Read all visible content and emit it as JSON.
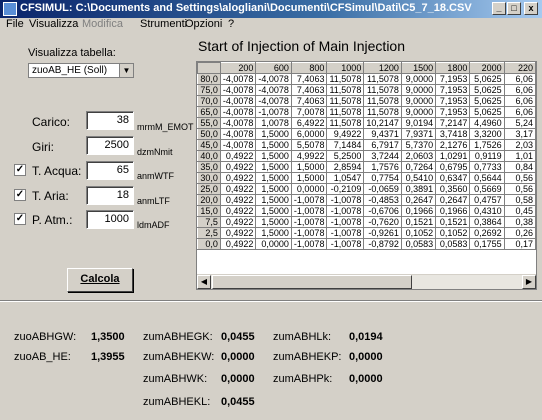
{
  "window": {
    "title": "CFSIMUL: C:\\Documents and Settings\\alogliani\\Documenti\\CFSimul\\Dati\\C5_7_18.CSV",
    "minimize": "_",
    "maximize": "□",
    "close": "x"
  },
  "menu": {
    "items": [
      "File",
      "Visualizza",
      "Modifica",
      "Strumenti",
      "Opzioni",
      "?"
    ]
  },
  "left": {
    "table_label": "Visualizza tabella:",
    "table_select": "zuoAB_HE (Soll)",
    "fields": [
      {
        "label": "Carico:",
        "value": "38",
        "unit": "mrmM_EMOT",
        "checked": false,
        "has_checkbox": false
      },
      {
        "label": "Giri:",
        "value": "2500",
        "unit": "dzmNmit",
        "checked": false,
        "has_checkbox": false
      },
      {
        "label": "T. Acqua:",
        "value": "65",
        "unit": "anmWTF",
        "checked": true,
        "has_checkbox": true
      },
      {
        "label": "T. Aria:",
        "value": "18",
        "unit": "anmLTF",
        "checked": true,
        "has_checkbox": true
      },
      {
        "label": "P. Atm.:",
        "value": "1000",
        "unit": "ldmADF",
        "checked": true,
        "has_checkbox": true
      }
    ],
    "calc_button": "Calcola"
  },
  "table": {
    "title": "Start of Injection of Main Injection",
    "columns": [
      "200",
      "600",
      "800",
      "1000",
      "1200",
      "1500",
      "1800",
      "2000",
      "220"
    ],
    "rows": [
      {
        "h": "80,0",
        "v": [
          "-4,0078",
          "-4,0078",
          "7,4063",
          "11,5078",
          "11,5078",
          "9,0000",
          "7,1953",
          "5,0625",
          "6,06"
        ]
      },
      {
        "h": "75,0",
        "v": [
          "-4,0078",
          "-4,0078",
          "7,4063",
          "11,5078",
          "11,5078",
          "9,0000",
          "7,1953",
          "5,0625",
          "6,06"
        ]
      },
      {
        "h": "70,0",
        "v": [
          "-4,0078",
          "-4,0078",
          "7,4063",
          "11,5078",
          "11,5078",
          "9,0000",
          "7,1953",
          "5,0625",
          "6,06"
        ]
      },
      {
        "h": "65,0",
        "v": [
          "-4,0078",
          "-1,0078",
          "7,0078",
          "11,5078",
          "11,5078",
          "9,0000",
          "7,1953",
          "5,0625",
          "6,06"
        ]
      },
      {
        "h": "55,0",
        "v": [
          "-4,0078",
          "1,0078",
          "6,4922",
          "11,5078",
          "10,2147",
          "9,0194",
          "7,2147",
          "4,4960",
          "5,24"
        ]
      },
      {
        "h": "50,0",
        "v": [
          "-4,0078",
          "1,5000",
          "6,0000",
          "9,4922",
          "9,4371",
          "7,9371",
          "3,7418",
          "3,3200",
          "3,17"
        ]
      },
      {
        "h": "45,0",
        "v": [
          "-4,0078",
          "1,5000",
          "5,5078",
          "7,1484",
          "6,7917",
          "5,7370",
          "2,1276",
          "1,7526",
          "2,03"
        ]
      },
      {
        "h": "40,0",
        "v": [
          "0,4922",
          "1,5000",
          "4,9922",
          "5,2500",
          "3,7244",
          "2,0603",
          "1,0291",
          "0,9119",
          "1,01"
        ]
      },
      {
        "h": "35,0",
        "v": [
          "0,4922",
          "1,5000",
          "1,5000",
          "2,8594",
          "1,7576",
          "0,7264",
          "0,6795",
          "0,7733",
          "0,84"
        ]
      },
      {
        "h": "30,0",
        "v": [
          "0,4922",
          "1,5000",
          "1,5000",
          "1,0547",
          "0,7754",
          "0,5410",
          "0,6347",
          "0,5644",
          "0,56"
        ]
      },
      {
        "h": "25,0",
        "v": [
          "0,4922",
          "1,5000",
          "0,0000",
          "-0,2109",
          "-0,0659",
          "0,3891",
          "0,3560",
          "0,5669",
          "0,56"
        ]
      },
      {
        "h": "20,0",
        "v": [
          "0,4922",
          "1,5000",
          "-1,0078",
          "-1,0078",
          "-0,4853",
          "0,2647",
          "0,2647",
          "0,4757",
          "0,58"
        ]
      },
      {
        "h": "15,0",
        "v": [
          "0,4922",
          "1,5000",
          "-1,0078",
          "-1,0078",
          "-0,6706",
          "0,1966",
          "0,1966",
          "0,4310",
          "0,45"
        ]
      },
      {
        "h": "7,5",
        "v": [
          "0,4922",
          "1,5000",
          "-1,0078",
          "-1,0078",
          "-0,7620",
          "0,1521",
          "0,1521",
          "0,3864",
          "0,38"
        ]
      },
      {
        "h": "2,5",
        "v": [
          "0,4922",
          "1,5000",
          "-1,0078",
          "-1,0078",
          "-0,9261",
          "0,1052",
          "0,1052",
          "0,2692",
          "0,26"
        ]
      },
      {
        "h": "0,0",
        "v": [
          "0,4922",
          "0,0000",
          "-1,0078",
          "-1,0078",
          "-0,8792",
          "0,0583",
          "0,0583",
          "0,1755",
          "0,17"
        ]
      }
    ]
  },
  "results": [
    {
      "label": "zuoABHGW:",
      "value": "1,3500"
    },
    {
      "label": "zuoAB_HE:",
      "value": "1,3955"
    },
    {
      "label": "zumABHEGK:",
      "value": "0,0455"
    },
    {
      "label": "zumABHEKW:",
      "value": "0,0000"
    },
    {
      "label": "zumABHWK:",
      "value": "0,0000"
    },
    {
      "label": "zumABHEKL:",
      "value": "0,0455"
    },
    {
      "label": "zumABHLk:",
      "value": "0,0194"
    },
    {
      "label": "zumABHEKP:",
      "value": "0,0000"
    },
    {
      "label": "zumABHPk:",
      "value": "0,0000"
    }
  ]
}
